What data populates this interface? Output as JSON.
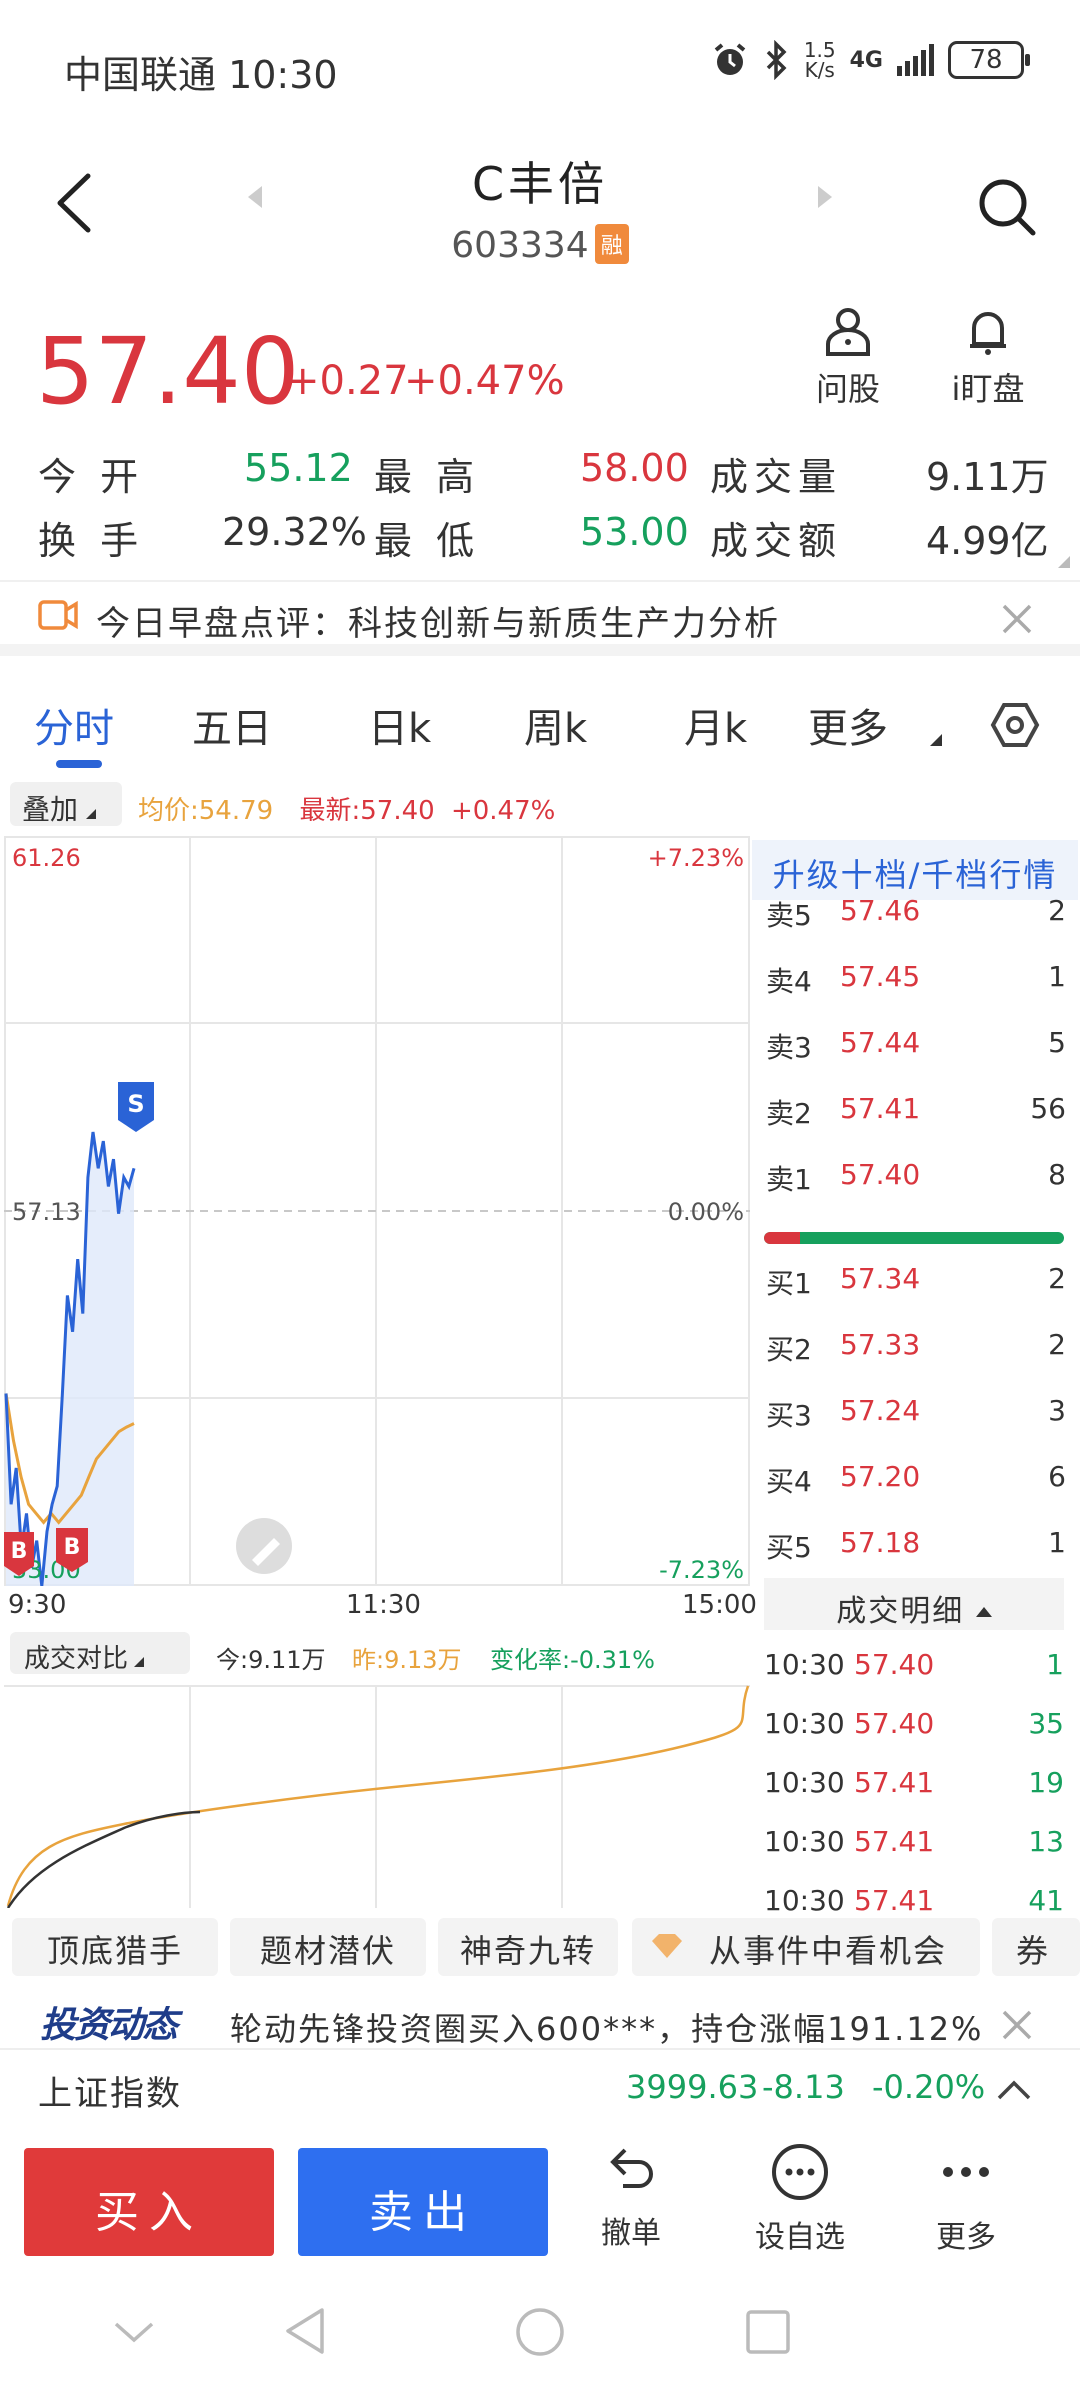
{
  "status_bar": {
    "carrier_time": "中国联通 10:30",
    "net_speed_value": "1.5",
    "net_speed_unit": "K/s",
    "network": "4G",
    "battery": "78"
  },
  "header": {
    "stock_name": "C丰倍",
    "stock_code": "603334",
    "margin_badge": "融"
  },
  "quote": {
    "price": "57.40",
    "change": "+0.27",
    "change_pct": "+0.47%",
    "ask_label": "问股",
    "watch_label": "i盯盘"
  },
  "stats": {
    "open_label": "今 开",
    "open": "55.12",
    "high_label": "最  高",
    "high": "58.00",
    "volume_label": "成交量",
    "volume": "9.11万",
    "turnover_label": "换 手",
    "turnover": "29.32%",
    "low_label": "最  低",
    "low": "53.00",
    "amount_label": "成交额",
    "amount": "4.99亿"
  },
  "banner": {
    "text": "今日早盘点评：科技创新与新质生产力分析"
  },
  "tabs": [
    {
      "label": "分时"
    },
    {
      "label": "五日"
    },
    {
      "label": "日k"
    },
    {
      "label": "周k"
    },
    {
      "label": "月k"
    },
    {
      "label": "更多"
    }
  ],
  "overlay": {
    "button": "叠加",
    "avg_price": "均价:54.79",
    "latest": "最新:57.40",
    "latest_pct": "+0.47%"
  },
  "chart": {
    "top_price": "61.26",
    "mid_price": "57.13",
    "bottom_price": "53.00",
    "top_pct": "+7.23%",
    "mid_pct": "0.00%",
    "bottom_pct": "-7.23%",
    "time_start": "9:30",
    "time_mid": "11:30",
    "time_end": "15:00",
    "marker_s": "S",
    "marker_b": "B"
  },
  "chart_data": {
    "type": "line",
    "title": "",
    "xlabel": "",
    "ylabel": "",
    "ylim": [
      53.0,
      61.26
    ],
    "x": [
      "9:30",
      "11:30",
      "15:00"
    ],
    "series": [
      {
        "name": "",
        "color": "#2a63d6",
        "values": [
          55.12,
          53.9,
          54.3,
          53.4,
          53.8,
          53.2,
          53.5,
          53.0,
          53.6,
          53.9,
          54.1,
          55.1,
          56.2,
          55.8,
          56.6,
          56.0,
          57.5,
          58.0,
          57.6,
          57.9,
          57.4,
          57.7,
          57.1,
          57.5,
          57.4,
          57.6
        ]
      },
      {
        "name": "均价",
        "color": "#e8a33d",
        "values": [
          55.12,
          54.6,
          54.2,
          53.9,
          53.8,
          53.7,
          53.8,
          53.7,
          53.8,
          53.9,
          54.0,
          54.2,
          54.4,
          54.5,
          54.6,
          54.7,
          54.75,
          54.79
        ]
      }
    ]
  },
  "volume_compare": {
    "label": "成交对比",
    "today": "今:9.11万",
    "yesterday": "昨:9.13万",
    "change_rate": "变化率:-0.31%"
  },
  "order_book": {
    "header": "升级十档/千档行情",
    "asks": [
      {
        "label": "卖5",
        "price": "57.46",
        "qty": "2"
      },
      {
        "label": "卖4",
        "price": "57.45",
        "qty": "1"
      },
      {
        "label": "卖3",
        "price": "57.44",
        "qty": "5"
      },
      {
        "label": "卖2",
        "price": "57.41",
        "qty": "56"
      },
      {
        "label": "卖1",
        "price": "57.40",
        "qty": "8"
      }
    ],
    "bids": [
      {
        "label": "买1",
        "price": "57.34",
        "qty": "2"
      },
      {
        "label": "买2",
        "price": "57.33",
        "qty": "2"
      },
      {
        "label": "买3",
        "price": "57.24",
        "qty": "3"
      },
      {
        "label": "买4",
        "price": "57.20",
        "qty": "6"
      },
      {
        "label": "买5",
        "price": "57.18",
        "qty": "1"
      }
    ],
    "sell_ratio": 0.12
  },
  "trades": {
    "header": "成交明细",
    "rows": [
      {
        "time": "10:30",
        "price": "57.40",
        "qty": "1"
      },
      {
        "time": "10:30",
        "price": "57.40",
        "qty": "35"
      },
      {
        "time": "10:30",
        "price": "57.41",
        "qty": "19"
      },
      {
        "time": "10:30",
        "price": "57.41",
        "qty": "13"
      },
      {
        "time": "10:30",
        "price": "57.41",
        "qty": "41"
      }
    ]
  },
  "strategy_tags": [
    {
      "label": "顶底猎手"
    },
    {
      "label": "题材潜伏"
    },
    {
      "label": "神奇九转"
    },
    {
      "label": "从事件中看机会"
    },
    {
      "label": "券商"
    }
  ],
  "news": {
    "logo": "投资动态",
    "text": "轮动先锋投资圈买入600***，持仓涨幅191.12%"
  },
  "index": {
    "name": "上证指数",
    "value": "3999.63",
    "change": "-8.13",
    "pct": "-0.20%"
  },
  "bottom": {
    "buy": "买入",
    "sell": "卖出",
    "cancel": "撤单",
    "watchlist": "设自选",
    "more": "更多"
  }
}
